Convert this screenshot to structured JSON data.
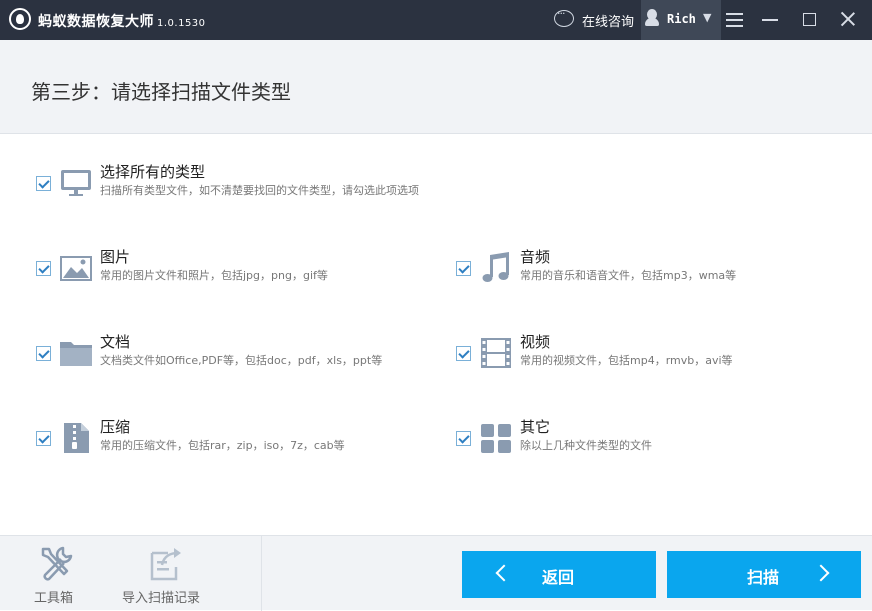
{
  "app": {
    "title": "蚂蚁数据恢复大师",
    "version": "1.0.1530"
  },
  "titlebar": {
    "consult_label": "在线咨询",
    "user_name": "Rich",
    "user_caret": "▼"
  },
  "step": {
    "title": "第三步：请选择扫描文件类型"
  },
  "select_all": {
    "label": "选择所有的类型",
    "desc": "扫描所有类型文件，如不清楚要找回的文件类型，请勾选此项选项",
    "checked": true,
    "icon": "monitor-icon"
  },
  "types": [
    {
      "label": "图片",
      "desc": "常用的图片文件和照片，包括jpg，png，gif等",
      "checked": true,
      "icon": "image-icon"
    },
    {
      "label": "音频",
      "desc": "常用的音乐和语音文件，包括mp3，wma等",
      "checked": true,
      "icon": "music-icon"
    },
    {
      "label": "文档",
      "desc": "文档类文件如Office,PDF等，包括doc，pdf，xls，ppt等",
      "checked": true,
      "icon": "folder-icon"
    },
    {
      "label": "视频",
      "desc": "常用的视频文件，包括mp4，rmvb，avi等",
      "checked": true,
      "icon": "film-icon"
    },
    {
      "label": "压缩",
      "desc": "常用的压缩文件，包括rar，zip，iso，7z，cab等",
      "checked": true,
      "icon": "zip-icon"
    },
    {
      "label": "其它",
      "desc": "除以上几种文件类型的文件",
      "checked": true,
      "icon": "grid-icon"
    }
  ],
  "footer": {
    "toolbox_label": "工具箱",
    "import_label": "导入扫描记录",
    "back_label": "返回",
    "scan_label": "扫描"
  },
  "colors": {
    "titlebar": "#2b3240",
    "accent": "#0aa6ee",
    "icon": "#8a9bb0",
    "panel": "#f1f3f6"
  }
}
